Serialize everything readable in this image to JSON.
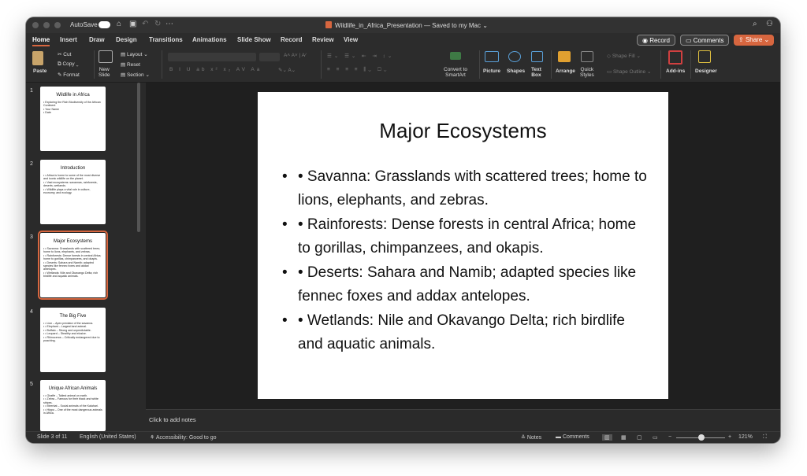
{
  "titlebar": {
    "autosave": "AutoSave",
    "title": "Wildlife_in_Africa_Presentation — Saved to my Mac ⌄"
  },
  "tabs": [
    "Home",
    "Insert",
    "Draw",
    "Design",
    "Transitions",
    "Animations",
    "Slide Show",
    "Record",
    "Review",
    "View"
  ],
  "top_buttons": {
    "record": "Record",
    "comments": "Comments",
    "share": "Share"
  },
  "ribbon": {
    "paste": "Paste",
    "cut": "Cut",
    "copy": "Copy",
    "format": "Format",
    "new_slide": [
      "New",
      "Slide"
    ],
    "layout": "Layout",
    "reset": "Reset",
    "section": "Section",
    "convert": [
      "Convert to",
      "SmartArt"
    ],
    "picture": "Picture",
    "shapes": "Shapes",
    "text_box": [
      "Text",
      "Box"
    ],
    "arrange": "Arrange",
    "quick_styles": [
      "Quick",
      "Styles"
    ],
    "shape_fill": "Shape Fill",
    "shape_outline": "Shape Outline",
    "add_ins": "Add-ins",
    "designer": "Designer"
  },
  "thumbnails": [
    {
      "num": "1",
      "title": "Wildlife in Africa",
      "bullets": [
        "• Exploring the Rich Biodiversity of the African Continent",
        "• Your Name",
        "• Date"
      ]
    },
    {
      "num": "2",
      "title": "Introduction",
      "bullets": [
        "• • Africa is home to some of the most diverse and iconic wildlife on the planet.",
        "• • Vast ecosystems: savannas, rainforests, deserts, wetlands.",
        "• • Wildlife plays a vital role in culture, economy, and ecology."
      ]
    },
    {
      "num": "3",
      "title": "Major Ecosystems",
      "bullets": [
        "• • Savanna: Grasslands with scattered trees; home to lions, elephants, and zebras.",
        "• • Rainforests: Dense forests in central Africa; home to gorillas, chimpanzees, and okapis.",
        "• • Deserts: Sahara and Namib; adapted species like fennec foxes and addax antelopes.",
        "• • Wetlands: Nile and Okavango Delta; rich birdlife and aquatic animals."
      ]
    },
    {
      "num": "4",
      "title": "The Big Five",
      "bullets": [
        "• • Lion – Apex predator of the savanna.",
        "• • Elephant – Largest land animal.",
        "• • Buffalo – Strong and unpredictable.",
        "• • Leopard – Stealthy and elusive.",
        "• • Rhinoceros – Critically endangered due to poaching."
      ]
    },
    {
      "num": "5",
      "title": "Unique African Animals",
      "bullets": [
        "• • Giraffe – Tallest animal on earth.",
        "• • Zebra – Famous for their black and white stripes.",
        "• • Meerkat – Social animals of the Kalahari.",
        "• • Hippo – One of the most dangerous animals in Africa."
      ]
    }
  ],
  "slide": {
    "title": "Major Ecosystems",
    "bullets": [
      "• Savanna: Grasslands with scattered trees; home to lions, elephants, and zebras.",
      "• Rainforests: Dense forests in central Africa; home to gorillas, chimpanzees, and okapis.",
      "• Deserts: Sahara and Namib; adapted species like fennec foxes and addax antelopes.",
      "• Wetlands: Nile and Okavango Delta; rich birdlife and aquatic animals."
    ]
  },
  "notes_placeholder": "Click to add notes",
  "status": {
    "slide": "Slide 3 of 11",
    "language": "English (United States)",
    "accessibility": "Accessibility: Good to go",
    "notes": "Notes",
    "comments": "Comments",
    "zoom": "121%"
  },
  "colors": {
    "accent": "#d7663f"
  }
}
